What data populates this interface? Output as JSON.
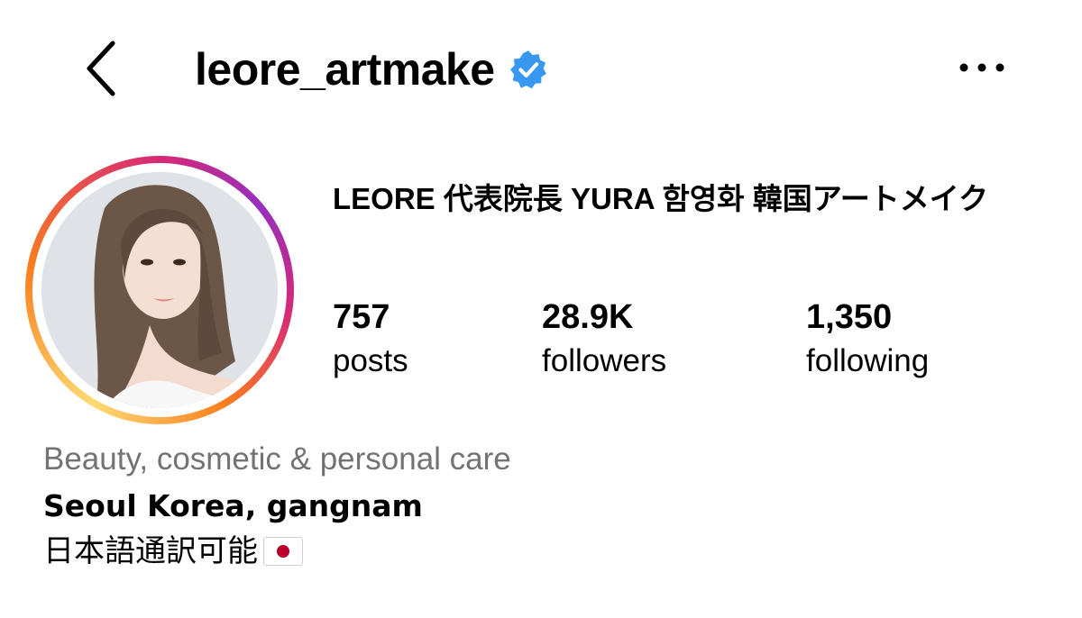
{
  "header": {
    "username": "leore_artmake",
    "back_icon": "chevron-left-icon",
    "verified_icon": "verified-badge-icon",
    "more_icon": "more-horizontal-icon"
  },
  "profile": {
    "display_name": "LEORE 代表院長 YURA 함영화 韓国アートメイク",
    "category": "Beauty, cosmetic & personal care",
    "location": "Seoul Korea, gangnam",
    "bio_text": "日本語通訳可能",
    "bio_emoji": "japan-flag-icon"
  },
  "stats": {
    "posts": {
      "value": "757",
      "label": "posts"
    },
    "followers": {
      "value": "28.9K",
      "label": "followers"
    },
    "following": {
      "value": "1,350",
      "label": "following"
    }
  },
  "colors": {
    "verified": "#3897f0",
    "secondary_text": "#737373",
    "story_ring_start": "#feda75",
    "story_ring_mid": "#d62976",
    "story_ring_end": "#962fbf"
  }
}
